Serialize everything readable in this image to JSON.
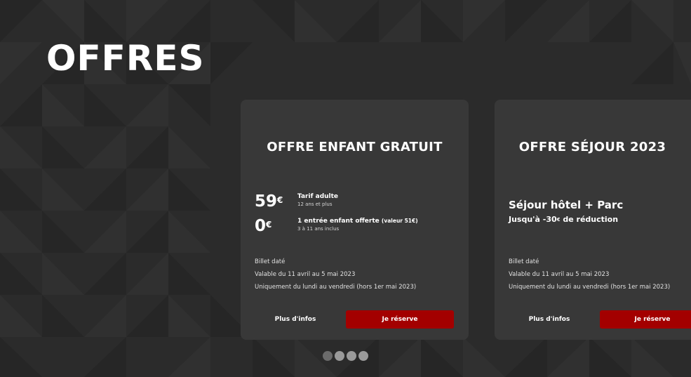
{
  "page": {
    "title": "OFFRES",
    "background_color": "#2b2b2b"
  },
  "offers": [
    {
      "title": "OFFRE ENFANT GRATUIT",
      "prices": [
        {
          "amount": "59",
          "currency": "€",
          "label": "Tarif adulte",
          "label_note": "",
          "sub": "12 ans et plus"
        },
        {
          "amount": "0",
          "currency": "€",
          "label": "1 entrée enfant offerte",
          "label_note": "(valeur 51€)",
          "sub": "3 à 11 ans inclus"
        }
      ],
      "details": [
        "Billet daté",
        "Valable du 11 avril au 5 mai 2023",
        "Uniquement du lundi au vendredi (hors 1er mai 2023)"
      ],
      "more_info_label": "Plus d'infos",
      "book_label": "Je réserve"
    },
    {
      "title": "OFFRE SÉJOUR 2023",
      "promo_title": "Séjour hôtel + Parc",
      "promo_prefix": "Jusqu'à -30",
      "promo_currency": "€",
      "promo_suffix": " de réduction",
      "details": [
        "Billet daté",
        "Valable du 11 avril au 5 mai 2023",
        "Uniquement du lundi au vendredi (hors 1er mai 2023)"
      ],
      "more_info_label": "Plus d'infos",
      "book_label": "Je réserve"
    }
  ],
  "carousel": {
    "page_count": 4,
    "dim_dot_index": 0
  },
  "colors": {
    "card_background": "#383838",
    "accent_button": "#a30000",
    "dot_active": "#9a9a9a",
    "dot_inactive": "#6b6b6b"
  }
}
